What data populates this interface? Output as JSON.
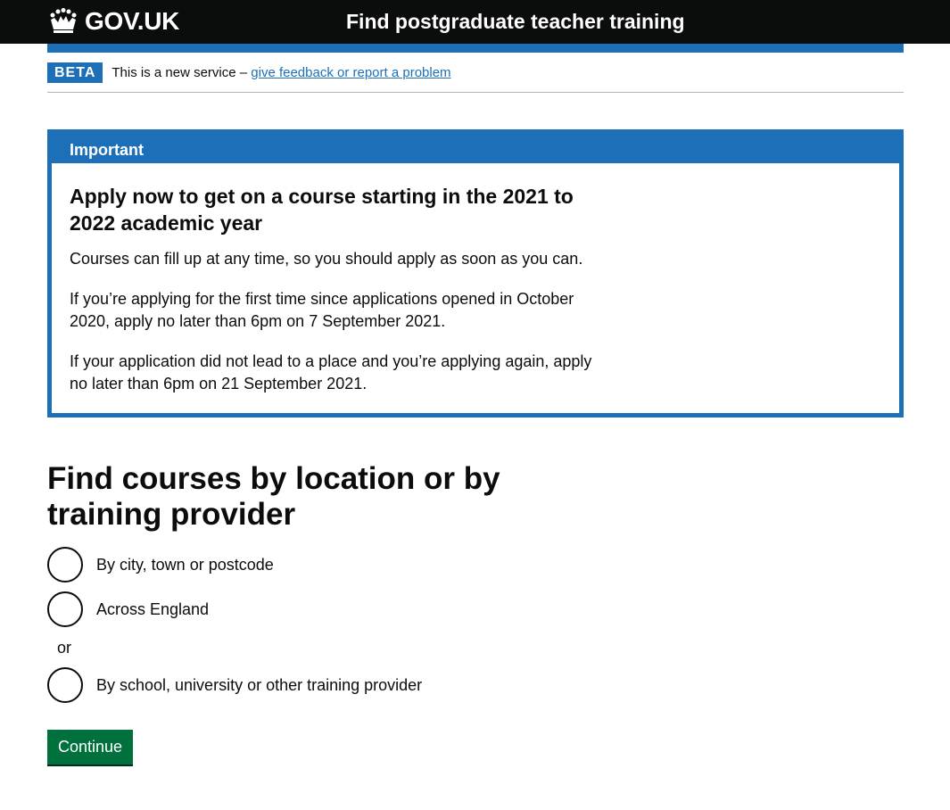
{
  "header": {
    "logo_text": "GOV.UK",
    "service_name": "Find postgraduate teacher training"
  },
  "phase_banner": {
    "tag": "BETA",
    "text": "This is a new service – ",
    "link": "give feedback or report a problem"
  },
  "notification": {
    "title": "Important",
    "heading": "Apply now to get on a course starting in the 2021 to 2022 academic year",
    "paragraphs": [
      "Courses can fill up at any time, so you should apply as soon as you can.",
      "If you’re applying for the first time since applications opened in October 2020, apply no later than 6pm on 7 September 2021.",
      "If your application did not lead to a place and you’re applying again, apply no later than 6pm on 21 September 2021."
    ]
  },
  "main": {
    "heading": "Find courses by location or by training provider",
    "radios": [
      {
        "label": "By city, town or postcode",
        "selected": false
      },
      {
        "label": "Across England",
        "selected": false
      },
      {
        "label": "By school, university or other training provider",
        "selected": false
      }
    ],
    "or_divider": "or",
    "continue_label": "Continue"
  },
  "colors": {
    "header_bg": "#0b0c0c",
    "brand_blue": "#1d70b8",
    "button_green": "#00703c",
    "text": "#0b0c0c"
  }
}
